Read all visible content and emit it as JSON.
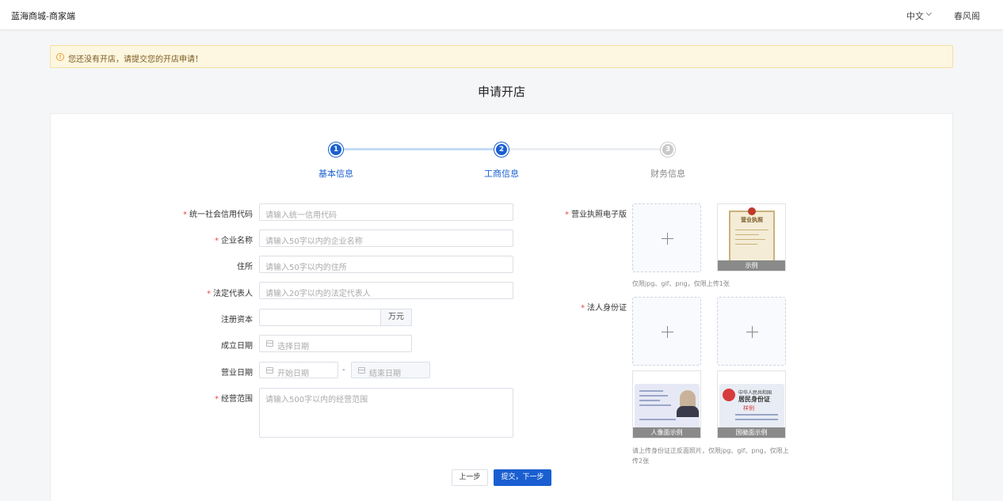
{
  "header": {
    "brand": "蓝海商城-商家端",
    "language": "中文",
    "user": "春风阁"
  },
  "alert": {
    "text": "您还没有开店，请提交您的开店申请！"
  },
  "page_title": "申请开店",
  "steps": [
    {
      "number": "1",
      "label": "基本信息",
      "state": "done"
    },
    {
      "number": "2",
      "label": "工商信息",
      "state": "active"
    },
    {
      "number": "3",
      "label": "财务信息",
      "state": "pending"
    }
  ],
  "colors": {
    "primary": "#1a5fd1",
    "step_line_done": "#c4dcf5",
    "pending": "#c9c9c9",
    "required": "#e74c3c"
  },
  "form": {
    "credit_code": {
      "label": "统一社会信用代码",
      "placeholder": "请输入统一信用代码",
      "value": ""
    },
    "company_name": {
      "label": "企业名称",
      "placeholder": "请输入50字以内的企业名称",
      "value": ""
    },
    "address": {
      "label": "住所",
      "placeholder": "请输入50字以内的住所",
      "value": ""
    },
    "legal_rep": {
      "label": "法定代表人",
      "placeholder": "请输入20字以内的法定代表人",
      "value": ""
    },
    "capital": {
      "label": "注册资本",
      "value": "",
      "suffix": "万元"
    },
    "founded": {
      "label": "成立日期",
      "placeholder": "选择日期"
    },
    "business_term": {
      "label": "营业日期",
      "start_placeholder": "开始日期",
      "separator": "-",
      "end_placeholder": "结束日期"
    },
    "scope": {
      "label": "经营范围",
      "placeholder": "请输入500字以内的经营范围",
      "value": ""
    }
  },
  "uploads": {
    "license": {
      "label": "营业执照电子版",
      "sample_caption": "示例",
      "sample_title": "营业执照",
      "hint": "仅限jpg、gif、png，仅限上传1张"
    },
    "id_card": {
      "label": "法人身份证",
      "front_caption": "人像面示例",
      "back_caption": "国徽面示例",
      "back_title_1": "中华人民共和国",
      "back_title_2": "居民身份证",
      "sample_stamp": "样例",
      "hint_line1": "请上传身份证正反面照片，仅限jpg、gif、png，仅限上",
      "hint_line2": "传2张"
    }
  },
  "buttons": {
    "prev": "上一步",
    "next": "提交，下一步"
  }
}
